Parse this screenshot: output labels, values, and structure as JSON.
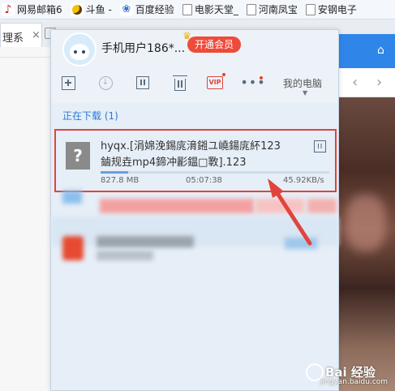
{
  "bookmarks": [
    {
      "label": "网易邮箱6",
      "icon": "mail-icon"
    },
    {
      "label": "斗鱼 -",
      "icon": "douyu-fish-icon"
    },
    {
      "label": "百度经验",
      "icon": "baidu-paw-icon"
    },
    {
      "label": "电影天堂_",
      "icon": "document-icon"
    },
    {
      "label": "河南凤宝",
      "icon": "document-icon"
    },
    {
      "label": "安钢电子",
      "icon": "document-icon"
    }
  ],
  "tab": {
    "label": "理系",
    "close": "×"
  },
  "panel": {
    "username": "手机用户186*...",
    "vip_button": "开通会员",
    "toolbar": {
      "add": "add-task-icon",
      "start": "start-download-icon",
      "pause": "pause-icon",
      "delete": "delete-icon",
      "vip": "VIP",
      "more": "•••",
      "my_computer": "我的电脑"
    },
    "section_label": "正在下载 (1)",
    "download": {
      "filename": "hyqx.[涓婂浼錫庣湇鎺ユ嶢鍚庣紑123鏀规垚mp4鍗冲彲鎾□斁].123",
      "size": "827.8 MB",
      "time": "05:07:38",
      "speed": "45.92KB/s",
      "progress": 0.12
    }
  },
  "watermark": {
    "text": "Bai 经验",
    "url": "jingyan.baidu.com"
  },
  "colors": {
    "accent": "#2b7bd6",
    "highlight_red": "#e0443b",
    "vip_red": "#ee4b3a"
  }
}
